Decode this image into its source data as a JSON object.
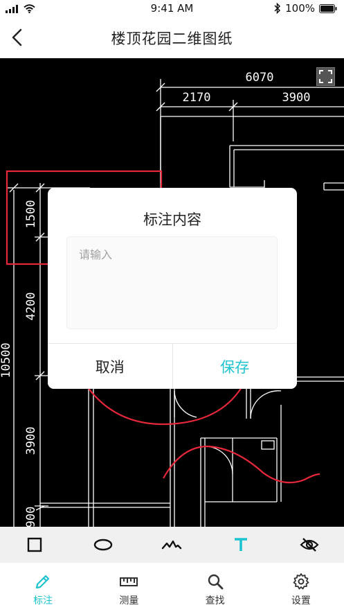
{
  "status_bar": {
    "time": "9:41 AM",
    "battery": "100%",
    "icons": [
      "signal-icon",
      "wifi-icon",
      "bluetooth-icon",
      "battery-icon"
    ]
  },
  "nav": {
    "title": "楼顶花园二维图纸",
    "back_icon": "chevron-left-icon"
  },
  "drawing": {
    "dimensions": {
      "top_total": "6070",
      "top_left": "2170",
      "top_right": "3900",
      "left_total": "10500",
      "left_1": "1500",
      "left_2": "4200",
      "left_3": "3900",
      "left_4": "900"
    },
    "fullscreen_icon": "fullscreen-icon",
    "annotation_color": "#e8283a",
    "line_color": "#ffffff"
  },
  "dialog": {
    "title": "标注内容",
    "placeholder": "请输入",
    "value": "",
    "cancel_label": "取消",
    "save_label": "保存"
  },
  "tools": [
    {
      "name": "rectangle-tool",
      "icon": "square-icon",
      "active": false
    },
    {
      "name": "ellipse-tool",
      "icon": "ellipse-icon",
      "active": false
    },
    {
      "name": "freehand-tool",
      "icon": "squiggle-icon",
      "active": false
    },
    {
      "name": "text-tool",
      "icon": "text-t-icon",
      "active": true
    },
    {
      "name": "hide-tool",
      "icon": "eye-off-icon",
      "active": false
    }
  ],
  "tabs": [
    {
      "label": "标注",
      "icon": "pencil-icon",
      "active": true
    },
    {
      "label": "测量",
      "icon": "ruler-icon",
      "active": false
    },
    {
      "label": "查找",
      "icon": "search-icon",
      "active": false
    },
    {
      "label": "设置",
      "icon": "gear-icon",
      "active": false
    }
  ],
  "colors": {
    "accent": "#1ec3d0",
    "toolbar_bg": "#f0f0f0",
    "drawing_bg": "#000000"
  }
}
